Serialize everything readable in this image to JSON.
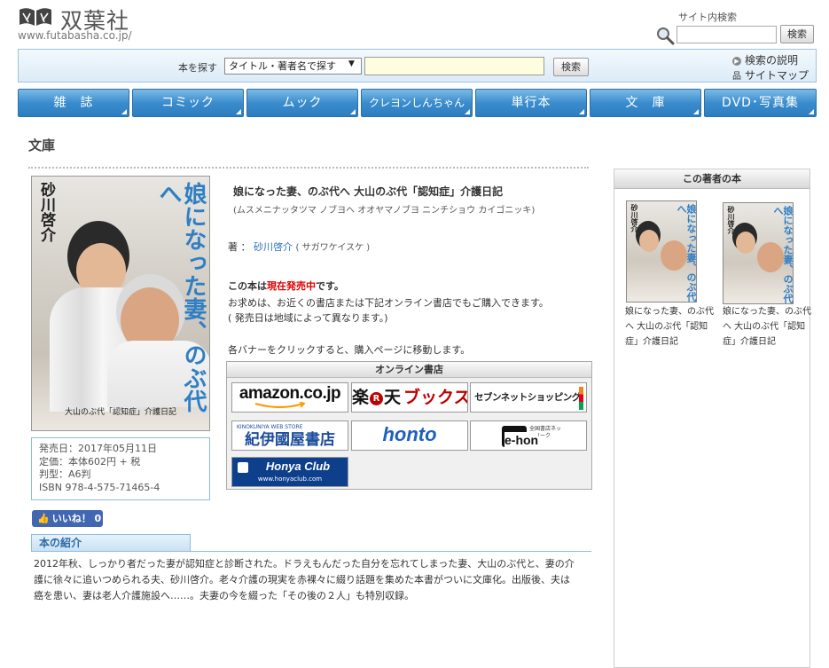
{
  "header": {
    "logo_text": "双葉社",
    "logo_url": "www.futabasha.co.jp/",
    "site_search_label": "サイト内検索",
    "site_search_button": "検索"
  },
  "book_search": {
    "label": "本を探す",
    "select_value": "タイトル・著者名で探す",
    "button": "検索",
    "help_link": "検索の説明",
    "sitemap_link": "サイトマップ"
  },
  "nav": [
    "雑　誌",
    "コミック",
    "ムック",
    "クレヨンしんちゃん",
    "単行本",
    "文　庫",
    "DVD･写真集"
  ],
  "page_title": "文庫",
  "cover": {
    "author": "砂川啓介",
    "title": "娘になった妻、のぶ代へ",
    "subtitle": "大山のぶ代「認知症」介護日記"
  },
  "book_info": {
    "release": "発売日：2017年05月11日",
    "price": "定価：本体602円 + 税",
    "format": "判型：A6判",
    "isbn": "ISBN 978-4-575-71465-4"
  },
  "like_button": "いいね！ 0",
  "book": {
    "title": "娘になった妻、のぶ代へ 大山のぶ代「認知症」介護日記",
    "title_kana": "(ムスメニナッタツマ ノブヨヘ オオヤマノブヨ ニンチショウ カイゴニッキ)",
    "author_prefix": "著 ：",
    "author_name": "砂川啓介",
    "author_kana": "( サガワケイスケ )",
    "status_pre": "この本は",
    "status_highlight": "現在発売中",
    "status_post": "です。",
    "buy_text": "お求めは、お近くの書店または下記オンライン書店でもご購入できます。",
    "date_note": "( 発売日は地域によって異なります。)",
    "banner_note": "各バナーをクリックすると、購入ページに移動します。"
  },
  "stores": {
    "heading": "オンライン書店",
    "amazon": "amazon.co.jp",
    "rakuten_a": "楽",
    "rakuten_b": "天",
    "rakuten_c": "ブックス",
    "seven": "セブンネットショッピング",
    "kinokuniya_small": "KINOKUNIYA WEB STORE",
    "kinokuniya": "紀伊國屋書店",
    "honto": "honto",
    "ehon_small": "全国書店ネットワーク",
    "ehon": "e-hon",
    "honyaclub": "Honya Club",
    "honyaclub_url": "www.honyaclub.com"
  },
  "intro": {
    "tab_label": "本の紹介",
    "text": "2012年秋、しっかり者だった妻が認知症と診断された。ドラえもんだった自分を忘れてしまった妻、大山のぶ代と、妻の介護に徐々に追いつめられる夫、砂川啓介。老々介護の現実を赤裸々に綴り話題を集めた本書がついに文庫化。出版後、夫は癌を患い、妻は老人介護施設へ……。夫妻の今を綴った「その後の２人」も特別収録。"
  },
  "sidebar": {
    "heading": "この著者の本",
    "books": [
      {
        "caption": "娘になった妻、のぶ代へ 大山のぶ代「認知症」介護日記"
      },
      {
        "caption": "娘になった妻、のぶ代へ 大山のぶ代「認知症」介護日記"
      }
    ]
  },
  "colors": {
    "nav_blue": "#3a8ccd",
    "link_blue": "#2874b8",
    "highlight_red": "#dd0000",
    "cover_title_blue": "#2f7fc4"
  }
}
